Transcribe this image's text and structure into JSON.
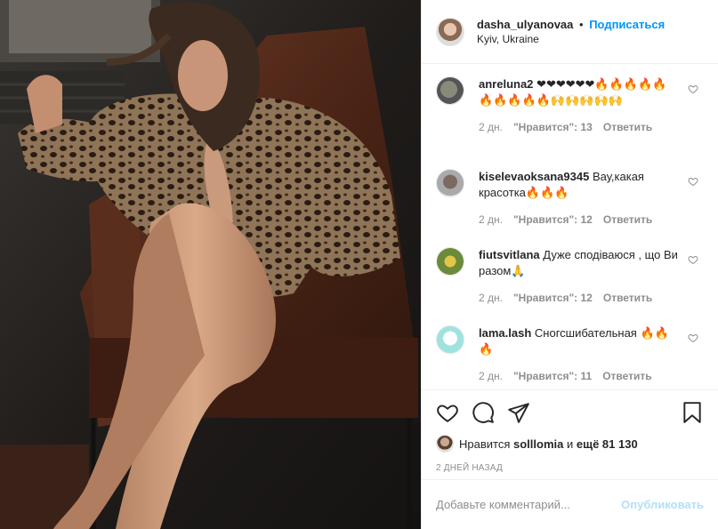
{
  "post": {
    "username": "dasha_ulyanovaa",
    "separator": "•",
    "follow_label": "Подписаться",
    "location": "Kyiv, Ukraine"
  },
  "comments": [
    {
      "user": "anreluna2",
      "text": "❤❤❤❤❤❤🔥🔥🔥🔥🔥🔥🔥🔥🔥🔥🙌🙌🙌🙌🙌",
      "time": "2 дн.",
      "likes": "\"Нравится\": 13",
      "reply": "Ответить"
    },
    {
      "user": "kiselevaoksana9345",
      "text": "Вау,какая красотка🔥🔥🔥",
      "time": "2 дн.",
      "likes": "\"Нравится\": 12",
      "reply": "Ответить"
    },
    {
      "user": "fiutsvitlana",
      "text": "Дуже сподіваюся , що Ви разом🙏",
      "time": "2 дн.",
      "likes": "\"Нравится\": 12",
      "reply": "Ответить"
    },
    {
      "user": "lama.lash",
      "text": "Сногсшибательная 🔥🔥🔥",
      "time": "2 дн.",
      "likes": "\"Нравится\": 11",
      "reply": "Ответить"
    }
  ],
  "likes": {
    "prefix": "Нравится",
    "user": "solllomia",
    "conj": "и",
    "count": "ещё 81 130"
  },
  "timestamp": "2 дней назад",
  "add_comment": {
    "placeholder": "Добавьте комментарий...",
    "publish_label": "Опубликовать"
  },
  "icons": {
    "like": "heart-icon",
    "comment": "comment-icon",
    "share": "share-icon",
    "save": "bookmark-icon"
  }
}
